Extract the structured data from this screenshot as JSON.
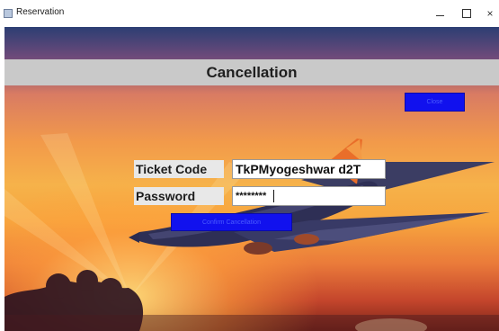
{
  "window": {
    "title": "Reservation",
    "icon": "app-window-icon"
  },
  "controls": {
    "minimize": "–",
    "maximize": "□",
    "close": "×"
  },
  "header": {
    "title": "Cancellation"
  },
  "close_button": {
    "label": "Close"
  },
  "form": {
    "ticket_label": "Ticket Code",
    "ticket_value": "TkPMyogeshwar d2T",
    "password_label": "Password",
    "password_value": "********"
  },
  "confirm_button": {
    "label": "Confirm Cancellation"
  },
  "colors": {
    "button_blue": "#1111ee",
    "banner_gray": "#c9c9c9"
  }
}
